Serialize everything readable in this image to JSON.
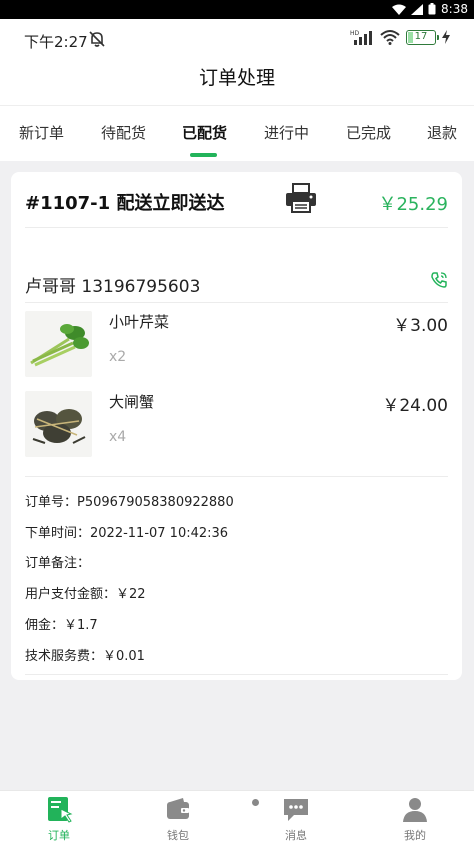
{
  "os": {
    "time": "8:38"
  },
  "status": {
    "time": "下午2:27",
    "signal_label": "HD",
    "battery": "17"
  },
  "header": {
    "title": "订单处理"
  },
  "tabs": [
    {
      "label": "新订单"
    },
    {
      "label": "待配货"
    },
    {
      "label": "已配货"
    },
    {
      "label": "进行中"
    },
    {
      "label": "已完成"
    },
    {
      "label": "退款"
    }
  ],
  "active_tab": "已配货",
  "order": {
    "title": "#1107-1 配送立即送达",
    "total": "￥25.29",
    "customer": "卢哥哥 13196795603",
    "items": [
      {
        "name": "小叶芹菜",
        "qty": "x2",
        "price": "￥3.00"
      },
      {
        "name": "大闸蟹",
        "qty": "x4",
        "price": "￥24.00"
      }
    ],
    "info": {
      "order_no": "订单号：P509679058380922880",
      "order_time": "下单时间：2022-11-07 10:42:36",
      "remark": "订单备注：",
      "paid": "用户支付金额：￥22",
      "commission": "佣金：￥1.7",
      "service_fee": "技术服务费：￥0.01"
    }
  },
  "nav": [
    {
      "label": "订单",
      "icon": "order-icon"
    },
    {
      "label": "钱包",
      "icon": "wallet-icon"
    },
    {
      "label": "消息",
      "icon": "message-icon"
    },
    {
      "label": "我的",
      "icon": "profile-icon"
    }
  ],
  "colors": {
    "accent": "#22b35a",
    "price": "#2bb35e"
  }
}
